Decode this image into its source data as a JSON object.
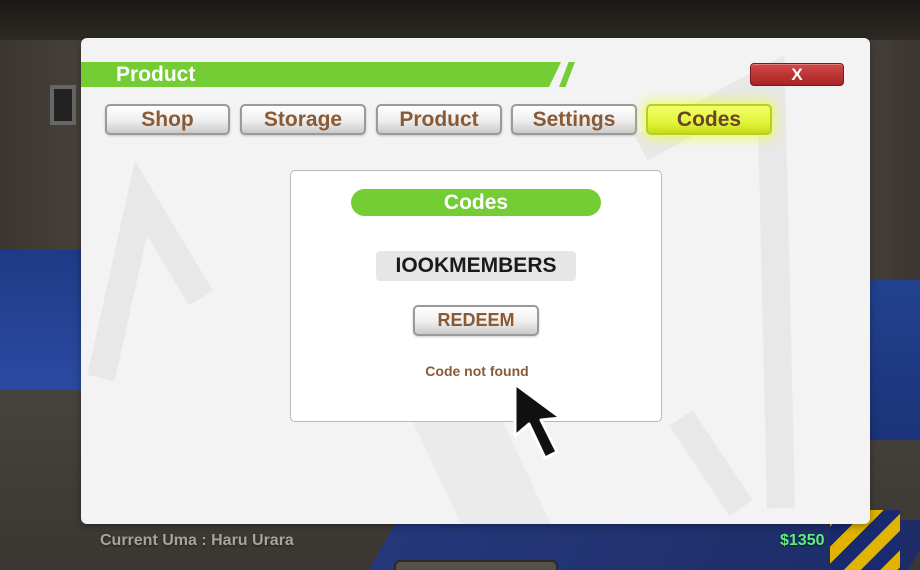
{
  "window": {
    "title": "Product",
    "close_label": "X"
  },
  "tabs": [
    {
      "label": "Shop",
      "active": false
    },
    {
      "label": "Storage",
      "active": false
    },
    {
      "label": "Product",
      "active": false
    },
    {
      "label": "Settings",
      "active": false
    },
    {
      "label": "Codes",
      "active": true
    }
  ],
  "codes_panel": {
    "header": "Codes",
    "code_value": "IOOKMEMBERS",
    "redeem_label": "REDEEM",
    "status": "Code not found"
  },
  "footer": {
    "current_uma": "Current Uma : Haru Urara",
    "money": "$1350"
  },
  "colors": {
    "accent_green": "#75cd35",
    "active_tab": "#e2f53a",
    "close_red": "#c03434",
    "tab_text": "#8a5a35",
    "money_green": "#5cf07d"
  },
  "icons": {
    "cursor": "arrow-pointer-icon"
  }
}
